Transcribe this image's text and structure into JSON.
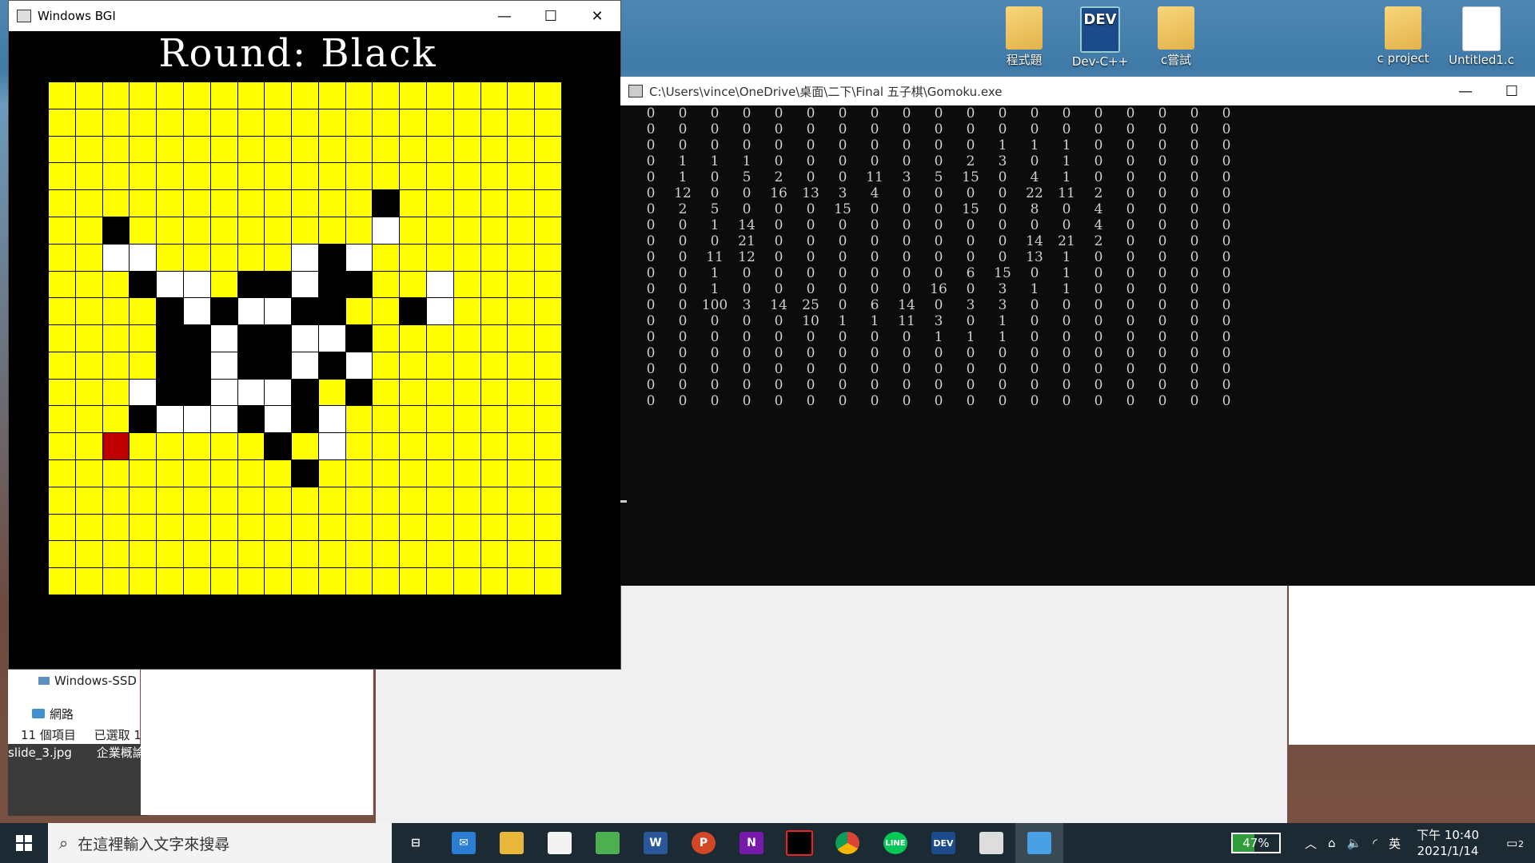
{
  "bgi_window": {
    "title": "Windows BGI",
    "round_label": "Round: Black",
    "board": [
      "...................",
      "...................",
      "...................",
      "...................",
      "............B......",
      "..B.........W......",
      "..WW.....WBW.......",
      "...BWW.BBWBB..W....",
      "....BWBWWBB..BW....",
      "....BBWBBWWB.......",
      "....BBWBBWBW.......",
      "...WBBWWWB.B.......",
      "...BWWWBWBW........",
      "..R.....B.W........",
      ".........B.........",
      "...................",
      "...................",
      "...................",
      "..................."
    ]
  },
  "console_window": {
    "title": "C:\\Users\\vince\\OneDrive\\桌面\\二下\\Final 五子棋\\Gomoku.exe",
    "rows": [
      [
        "0",
        "0",
        "0",
        "0",
        "0",
        "0",
        "0",
        "0",
        "0",
        "0",
        "0",
        "0",
        "0",
        "0",
        "0",
        "0",
        "0",
        "0",
        "0"
      ],
      [
        "0",
        "0",
        "0",
        "0",
        "0",
        "0",
        "0",
        "0",
        "0",
        "0",
        "0",
        "0",
        "0",
        "0",
        "0",
        "0",
        "0",
        "0",
        "0"
      ],
      [
        "0",
        "0",
        "0",
        "0",
        "0",
        "0",
        "0",
        "0",
        "0",
        "0",
        "0",
        "1",
        "1",
        "1",
        "0",
        "0",
        "0",
        "0",
        "0"
      ],
      [
        "0",
        "1",
        "1",
        "1",
        "0",
        "0",
        "0",
        "0",
        "0",
        "0",
        "2",
        "3",
        "0",
        "1",
        "0",
        "0",
        "0",
        "0",
        "0"
      ],
      [
        "0",
        "1",
        "0",
        "5",
        "2",
        "0",
        "0",
        "11",
        "3",
        "5",
        "15",
        "0",
        "4",
        "1",
        "0",
        "0",
        "0",
        "0",
        "0"
      ],
      [
        "0",
        "12",
        "0",
        "0",
        "16",
        "13",
        "3",
        "4",
        "0",
        "0",
        "0",
        "0",
        "22",
        "11",
        "2",
        "0",
        "0",
        "0",
        "0"
      ],
      [
        "0",
        "2",
        "5",
        "0",
        "0",
        "0",
        "15",
        "0",
        "0",
        "0",
        "15",
        "0",
        "8",
        "0",
        "4",
        "0",
        "0",
        "0",
        "0"
      ],
      [
        "0",
        "0",
        "1",
        "14",
        "0",
        "0",
        "0",
        "0",
        "0",
        "0",
        "0",
        "0",
        "0",
        "0",
        "4",
        "0",
        "0",
        "0",
        "0"
      ],
      [
        "0",
        "0",
        "0",
        "21",
        "0",
        "0",
        "0",
        "0",
        "0",
        "0",
        "0",
        "0",
        "14",
        "21",
        "2",
        "0",
        "0",
        "0",
        "0"
      ],
      [
        "0",
        "0",
        "11",
        "12",
        "0",
        "0",
        "0",
        "0",
        "0",
        "0",
        "0",
        "0",
        "13",
        "1",
        "0",
        "0",
        "0",
        "0",
        "0"
      ],
      [
        "0",
        "0",
        "1",
        "0",
        "0",
        "0",
        "0",
        "0",
        "0",
        "0",
        "6",
        "15",
        "0",
        "1",
        "0",
        "0",
        "0",
        "0",
        "0"
      ],
      [
        "0",
        "0",
        "1",
        "0",
        "0",
        "0",
        "0",
        "0",
        "0",
        "16",
        "0",
        "3",
        "1",
        "1",
        "0",
        "0",
        "0",
        "0",
        "0"
      ],
      [
        "0",
        "0",
        "100",
        "3",
        "14",
        "25",
        "0",
        "6",
        "14",
        "0",
        "3",
        "3",
        "0",
        "0",
        "0",
        "0",
        "0",
        "0",
        "0"
      ],
      [
        "0",
        "0",
        "0",
        "0",
        "0",
        "10",
        "1",
        "1",
        "11",
        "3",
        "0",
        "1",
        "0",
        "0",
        "0",
        "0",
        "0",
        "0",
        "0"
      ],
      [
        "0",
        "0",
        "0",
        "0",
        "0",
        "0",
        "0",
        "0",
        "0",
        "1",
        "1",
        "1",
        "0",
        "0",
        "0",
        "0",
        "0",
        "0",
        "0"
      ],
      [
        "0",
        "0",
        "0",
        "0",
        "0",
        "0",
        "0",
        "0",
        "0",
        "0",
        "0",
        "0",
        "0",
        "0",
        "0",
        "0",
        "0",
        "0",
        "0"
      ],
      [
        "0",
        "0",
        "0",
        "0",
        "0",
        "0",
        "0",
        "0",
        "0",
        "0",
        "0",
        "0",
        "0",
        "0",
        "0",
        "0",
        "0",
        "0",
        "0"
      ],
      [
        "0",
        "0",
        "0",
        "0",
        "0",
        "0",
        "0",
        "0",
        "0",
        "0",
        "0",
        "0",
        "0",
        "0",
        "0",
        "0",
        "0",
        "0",
        "0"
      ],
      [
        "0",
        "0",
        "0",
        "0",
        "0",
        "0",
        "0",
        "0",
        "0",
        "0",
        "0",
        "0",
        "0",
        "0",
        "0",
        "0",
        "0",
        "0",
        "0"
      ]
    ]
  },
  "desktop_icons": [
    {
      "label": "程式題",
      "icon": "folder-icon"
    },
    {
      "label": "Dev-C++",
      "icon": "devcpp-icon"
    },
    {
      "label": "c嘗試",
      "icon": "folder-icon"
    },
    {
      "label": "c project",
      "icon": "folder-icon"
    },
    {
      "label": "Untitled1.c",
      "icon": "c-file-icon"
    }
  ],
  "explorer": {
    "nav_drive": "Windows-SSD",
    "nav_network": "網路",
    "item_count": "11 個項目",
    "selected": "已選取 1",
    "file_name": "slide_3.jpg",
    "file_desc": "企業概論"
  },
  "taskbar": {
    "search_placeholder": "在這裡輸入文字來搜尋",
    "battery": "47%",
    "ime": "英",
    "time": "下午 10:40",
    "date": "2021/1/14",
    "notifications": "2"
  }
}
